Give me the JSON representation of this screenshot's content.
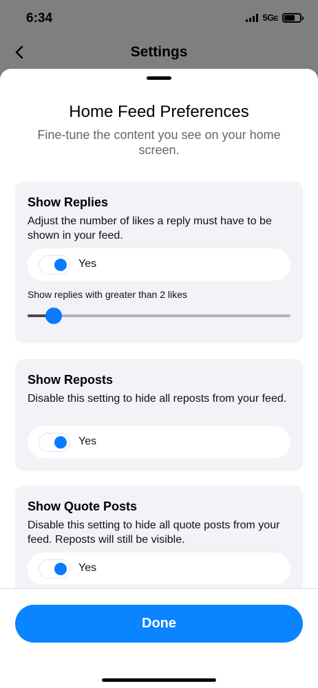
{
  "status": {
    "time": "6:34",
    "network": "5G",
    "network_suffix": "E"
  },
  "nav": {
    "title": "Settings",
    "back_icon": "chevron-left-icon"
  },
  "sheet": {
    "title": "Home Feed Preferences",
    "subtitle": "Fine-tune the content you see on your home screen."
  },
  "sections": {
    "replies": {
      "title": "Show Replies",
      "description": "Adjust the number of likes a reply must have to be shown in your feed.",
      "toggle_label": "Yes",
      "toggle_on": true,
      "slider_label": "Show replies with greater than 2 likes",
      "slider_fraction": 0.1
    },
    "reposts": {
      "title": "Show Reposts",
      "description": "Disable this setting to hide all reposts from your feed.",
      "toggle_label": "Yes",
      "toggle_on": true
    },
    "quotes": {
      "title": "Show Quote Posts",
      "description": "Disable this setting to hide all quote posts from your feed. Reposts will still be visible.",
      "toggle_label": "Yes",
      "toggle_on": true
    }
  },
  "footer": {
    "done_label": "Done"
  },
  "colors": {
    "accent": "#0a84ff",
    "card_bg": "#f2f2f7",
    "backdrop": "#7f7f7f"
  }
}
